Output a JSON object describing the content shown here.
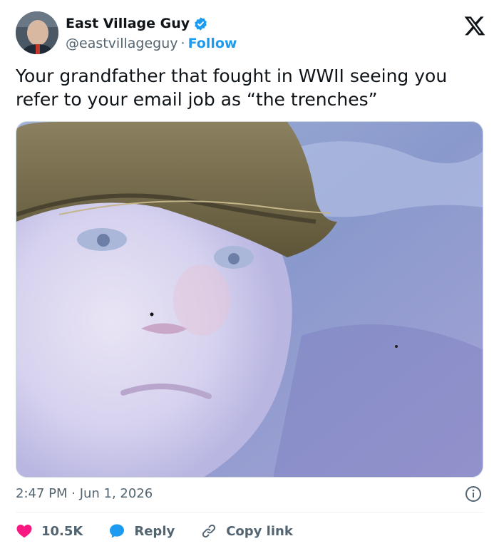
{
  "author": {
    "display_name": "East Village Guy",
    "handle": "@eastvillageguy",
    "separator": "·",
    "follow_label": "Follow",
    "verified": true
  },
  "platform": {
    "logo": "x-logo-icon"
  },
  "tweet": {
    "text": "Your grandfather that fought in WWII seeing you refer to your email job as “the trenches”",
    "media": "meme-image"
  },
  "meta": {
    "timestamp": "2:47 PM · Jun 1, 2026",
    "info_icon": "info-icon"
  },
  "actions": {
    "like_count": "10.5K",
    "reply_label": "Reply",
    "copy_link_label": "Copy link"
  },
  "colors": {
    "accent": "#1d9bf0",
    "like": "#f91880",
    "text": "#0f1419",
    "muted": "#536471"
  }
}
